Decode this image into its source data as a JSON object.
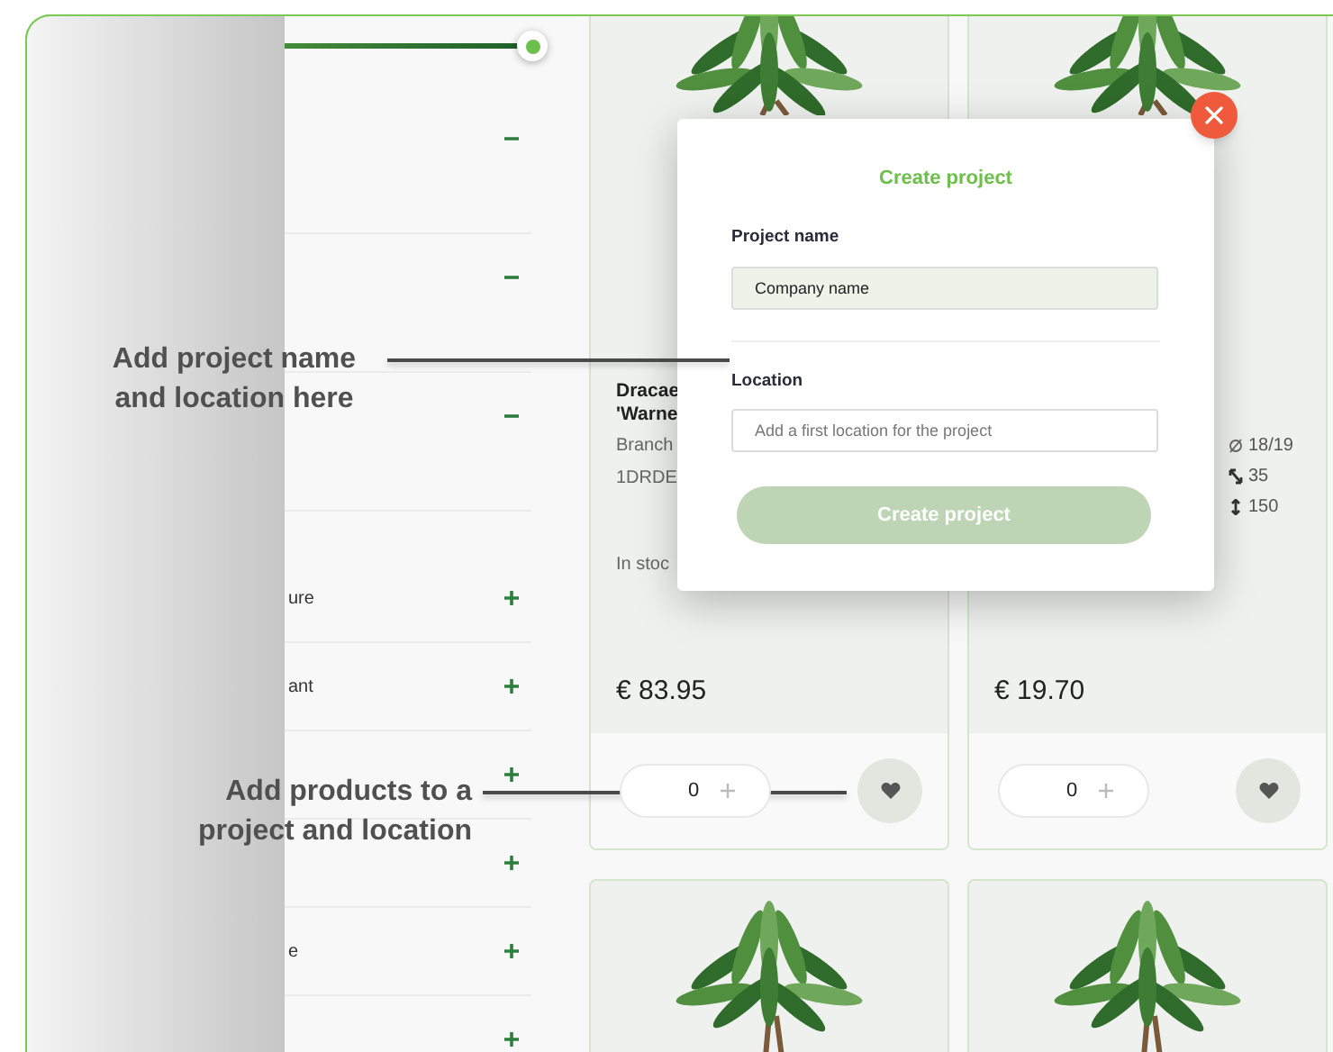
{
  "sidebar": {
    "price_slider": {
      "level": 1
    },
    "filters": [
      {
        "expanded": true
      },
      {
        "expanded": true
      },
      {
        "expanded": true
      },
      {
        "label": "ure",
        "expanded": false
      },
      {
        "label": "ant",
        "expanded": false
      },
      {
        "expanded": false
      },
      {
        "expanded": false
      },
      {
        "label": "e",
        "expanded": false
      },
      {
        "expanded": false
      }
    ]
  },
  "products": [
    {
      "name": "Dracae\n'Warne",
      "details": [
        "Branch",
        "1DRDE"
      ],
      "stock": "In stoc",
      "price": "€ 83.95",
      "quantity": "0"
    },
    {
      "specs": [
        {
          "kind": "diameter",
          "text": "18/19"
        },
        {
          "kind": "spread",
          "text": "35"
        },
        {
          "kind": "height",
          "text": "150"
        }
      ],
      "price": "€ 19.70",
      "quantity": "0"
    },
    {
      "kind": "picture"
    },
    {
      "kind": "picture"
    }
  ],
  "dialog": {
    "title": "Create project",
    "fields": [
      {
        "label": "Project name",
        "value": "Company name"
      },
      {
        "label": "Location",
        "placeholder": "Add a first location for the project"
      }
    ],
    "submit": {
      "label": "Create project",
      "disabled": true
    }
  },
  "annotations": [
    {
      "text": "Add project name\nand location here"
    },
    {
      "text": "Add products to a\nproject and location"
    }
  ]
}
